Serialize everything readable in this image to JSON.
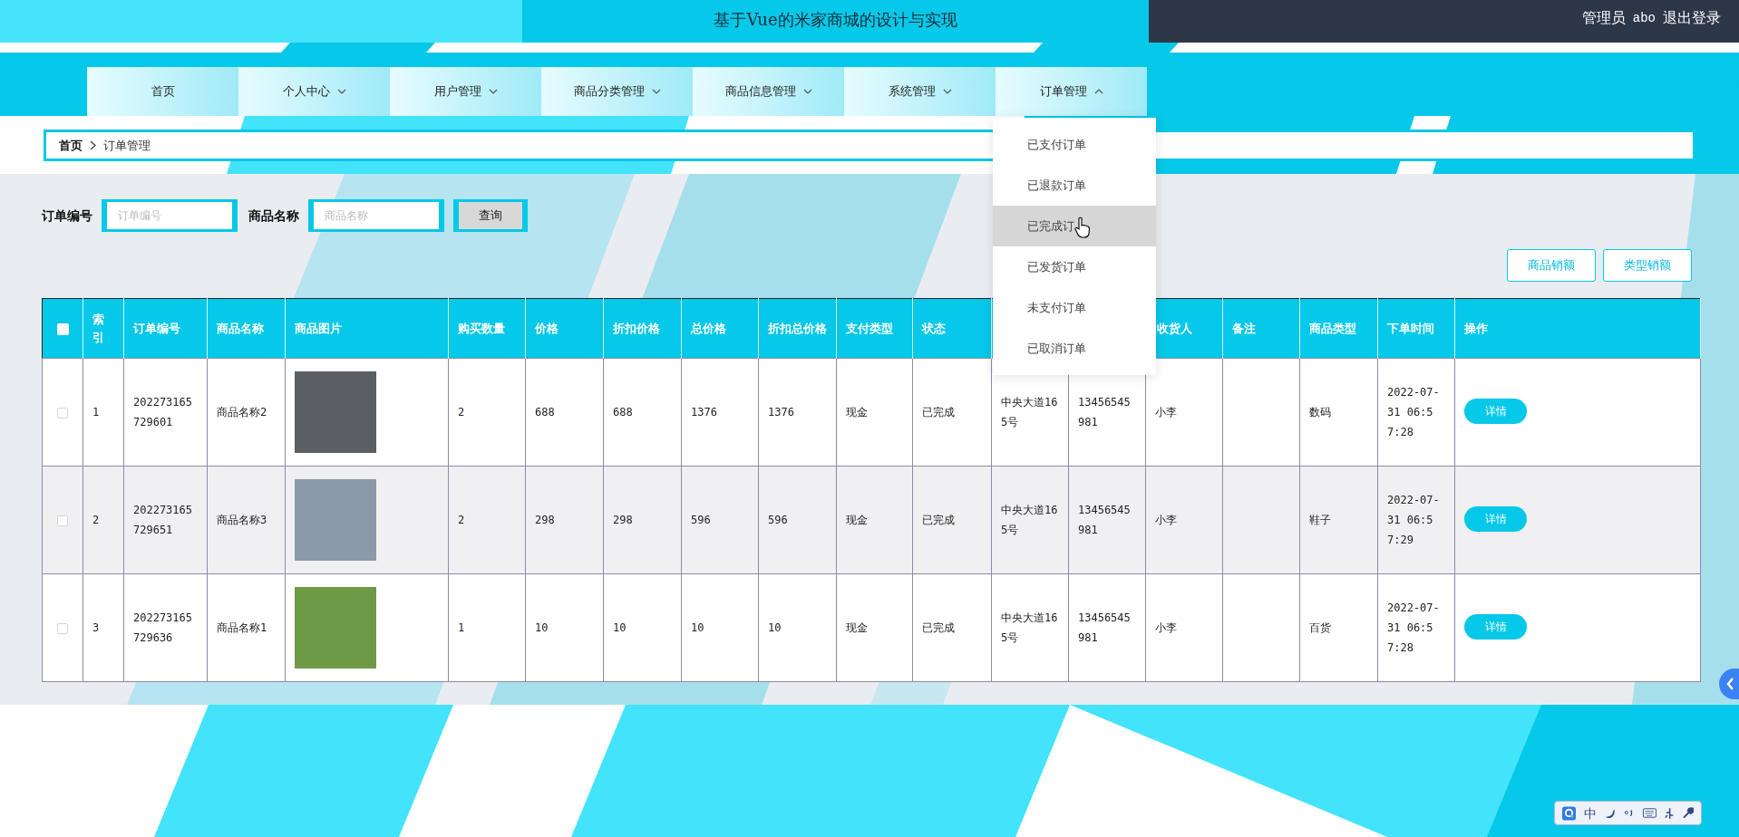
{
  "header": {
    "title": "基于Vue的米家商城的设计与实现",
    "user_role": "管理员",
    "username": "abo",
    "logout": "退出登录"
  },
  "nav": [
    {
      "label": "首页",
      "kind": "link"
    },
    {
      "label": "个人中心",
      "kind": "menu",
      "expanded": false
    },
    {
      "label": "用户管理",
      "kind": "menu",
      "expanded": false
    },
    {
      "label": "商品分类管理",
      "kind": "menu",
      "expanded": false
    },
    {
      "label": "商品信息管理",
      "kind": "menu",
      "expanded": false
    },
    {
      "label": "系统管理",
      "kind": "menu",
      "expanded": false
    },
    {
      "label": "订单管理",
      "kind": "menu",
      "expanded": true
    }
  ],
  "nav_menu": {
    "items": [
      {
        "label": "已支付订单",
        "highlighted": false
      },
      {
        "label": "已退款订单",
        "highlighted": false
      },
      {
        "label": "已完成订",
        "highlighted": true
      },
      {
        "label": "已发货订单",
        "highlighted": false
      },
      {
        "label": "未支付订单",
        "highlighted": false
      },
      {
        "label": "已取消订单",
        "highlighted": false
      }
    ]
  },
  "breadcrumb": [
    "首页",
    "订单管理"
  ],
  "search": {
    "fields": [
      {
        "label": "订单编号",
        "placeholder": "订单编号"
      },
      {
        "label": "商品名称",
        "placeholder": "商品名称"
      }
    ],
    "button": "查询"
  },
  "actions": [
    "商品销额",
    "类型销额"
  ],
  "table": {
    "header_checked": false,
    "columns": [
      {
        "label": "索引"
      },
      {
        "label": "订单编号"
      },
      {
        "label": "商品名称"
      },
      {
        "label": "商品图片"
      },
      {
        "label": "购买数量"
      },
      {
        "label": "价格"
      },
      {
        "label": "折扣价格"
      },
      {
        "label": "总价格"
      },
      {
        "label": "折扣总价格"
      },
      {
        "label": "支付类型"
      },
      {
        "label": "状态"
      },
      {},
      {},
      {
        "label": "收货人"
      },
      {
        "label": "备注"
      },
      {
        "label": "商品类型"
      },
      {
        "label": "下单时间"
      },
      {
        "label": "操作"
      }
    ],
    "rows": [
      {
        "checked": false,
        "index": "1",
        "order_no": "202273165729601",
        "product": "商品名称2",
        "quantity": "2",
        "price": "688",
        "discount_price": "688",
        "total": "1376",
        "discount_total": "1376",
        "payment": "现金",
        "status": "已完成",
        "address": "中央大道165号",
        "phone": "13456545981",
        "receiver": "小李",
        "category": "数码",
        "time": "2022-07-31 06:57:28",
        "action": "详情"
      },
      {
        "checked": false,
        "index": "2",
        "order_no": "202273165729651",
        "product": "商品名称3",
        "quantity": "2",
        "price": "298",
        "discount_price": "298",
        "total": "596",
        "discount_total": "596",
        "payment": "现金",
        "status": "已完成",
        "address": "中央大道165号",
        "phone": "13456545981",
        "receiver": "小李",
        "category": "鞋子",
        "time": "2022-07-31 06:57:29",
        "action": "详情"
      },
      {
        "checked": false,
        "index": "3",
        "order_no": "202273165729636",
        "product": "商品名称1",
        "quantity": "1",
        "price": "10",
        "discount_price": "10",
        "total": "10",
        "discount_total": "10",
        "payment": "现金",
        "status": "已完成",
        "address": "中央大道165号",
        "phone": "13456545981",
        "receiver": "小李",
        "category": "百货",
        "time": "2022-07-31 06:57:28",
        "action": "详情"
      }
    ]
  },
  "ime_toolbar": {
    "mode": "中"
  }
}
